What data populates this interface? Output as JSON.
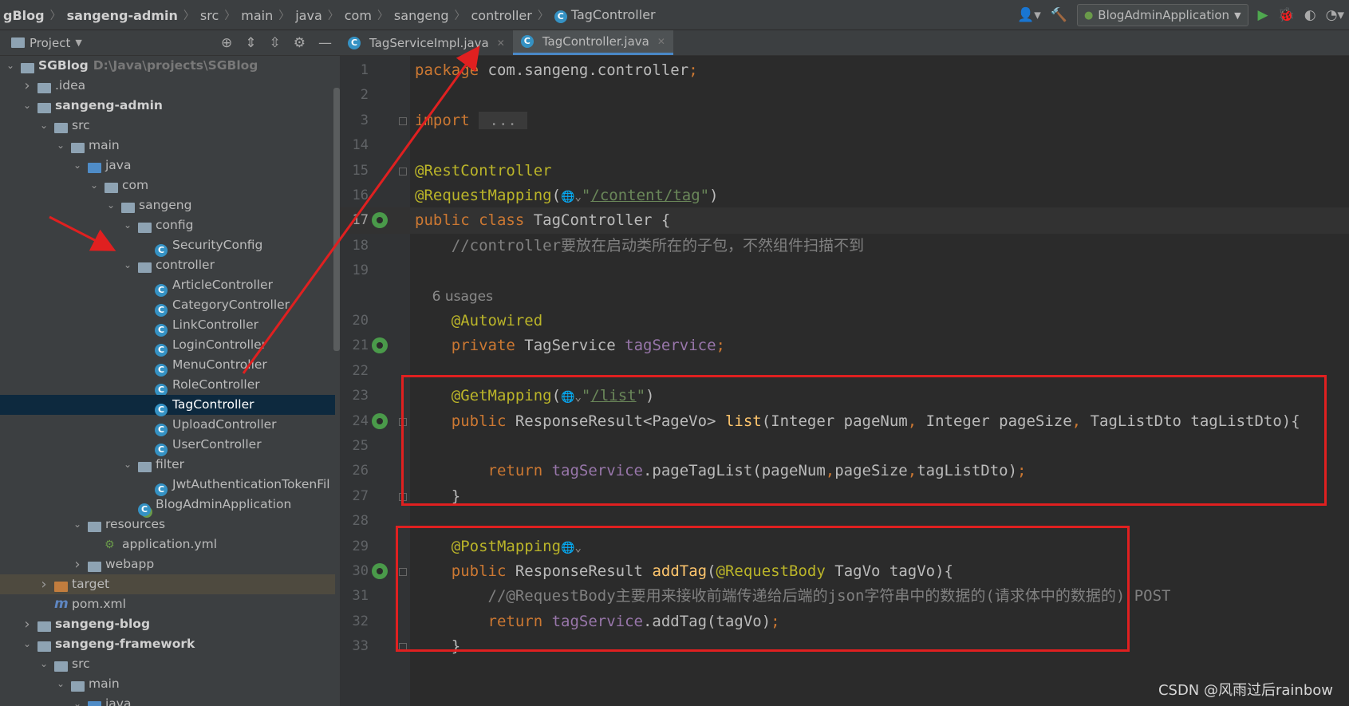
{
  "breadcrumb": [
    "gBlog",
    "sangeng-admin",
    "src",
    "main",
    "java",
    "com",
    "sangeng",
    "controller",
    "TagController"
  ],
  "run_config": "BlogAdminApplication",
  "project_panel": {
    "title": "Project",
    "tree": [
      {
        "label": "SGBlog",
        "path": "D:\\Java\\projects\\SGBlog",
        "bold": true,
        "depth": 0,
        "arrow": "open",
        "icon": "module"
      },
      {
        "label": ".idea",
        "depth": 1,
        "arrow": "closed",
        "icon": "folder"
      },
      {
        "label": "sangeng-admin",
        "depth": 1,
        "arrow": "open",
        "icon": "module",
        "bold": true
      },
      {
        "label": "src",
        "depth": 2,
        "arrow": "open",
        "icon": "folder"
      },
      {
        "label": "main",
        "depth": 3,
        "arrow": "open",
        "icon": "folder"
      },
      {
        "label": "java",
        "depth": 4,
        "arrow": "open",
        "icon": "folder-blue"
      },
      {
        "label": "com",
        "depth": 5,
        "arrow": "open",
        "icon": "folder"
      },
      {
        "label": "sangeng",
        "depth": 6,
        "arrow": "open",
        "icon": "folder"
      },
      {
        "label": "config",
        "depth": 7,
        "arrow": "open",
        "icon": "folder"
      },
      {
        "label": "SecurityConfig",
        "depth": 8,
        "arrow": "",
        "icon": "class"
      },
      {
        "label": "controller",
        "depth": 7,
        "arrow": "open",
        "icon": "folder"
      },
      {
        "label": "ArticleController",
        "depth": 8,
        "arrow": "",
        "icon": "class"
      },
      {
        "label": "CategoryController",
        "depth": 8,
        "arrow": "",
        "icon": "class"
      },
      {
        "label": "LinkController",
        "depth": 8,
        "arrow": "",
        "icon": "class"
      },
      {
        "label": "LoginController",
        "depth": 8,
        "arrow": "",
        "icon": "class"
      },
      {
        "label": "MenuController",
        "depth": 8,
        "arrow": "",
        "icon": "class"
      },
      {
        "label": "RoleController",
        "depth": 8,
        "arrow": "",
        "icon": "class"
      },
      {
        "label": "TagController",
        "depth": 8,
        "arrow": "",
        "icon": "class",
        "selected": true
      },
      {
        "label": "UploadController",
        "depth": 8,
        "arrow": "",
        "icon": "class"
      },
      {
        "label": "UserController",
        "depth": 8,
        "arrow": "",
        "icon": "class"
      },
      {
        "label": "filter",
        "depth": 7,
        "arrow": "open",
        "icon": "folder"
      },
      {
        "label": "JwtAuthenticationTokenFil",
        "depth": 8,
        "arrow": "",
        "icon": "class"
      },
      {
        "label": "BlogAdminApplication",
        "depth": 7,
        "arrow": "",
        "icon": "spring-class"
      },
      {
        "label": "resources",
        "depth": 4,
        "arrow": "open",
        "icon": "folder"
      },
      {
        "label": "application.yml",
        "depth": 5,
        "arrow": "",
        "icon": "spring-yml"
      },
      {
        "label": "webapp",
        "depth": 4,
        "arrow": "closed",
        "icon": "folder"
      },
      {
        "label": "target",
        "depth": 2,
        "arrow": "closed",
        "icon": "folder-orange",
        "target": true
      },
      {
        "label": "pom.xml",
        "depth": 2,
        "arrow": "",
        "icon": "maven"
      },
      {
        "label": "sangeng-blog",
        "depth": 1,
        "arrow": "closed",
        "icon": "module",
        "bold": true
      },
      {
        "label": "sangeng-framework",
        "depth": 1,
        "arrow": "open",
        "icon": "module",
        "bold": true
      },
      {
        "label": "src",
        "depth": 2,
        "arrow": "open",
        "icon": "folder"
      },
      {
        "label": "main",
        "depth": 3,
        "arrow": "open",
        "icon": "folder"
      },
      {
        "label": "java",
        "depth": 4,
        "arrow": "open",
        "icon": "folder-blue"
      }
    ]
  },
  "editor": {
    "tabs": [
      {
        "label": "TagServiceImpl.java",
        "active": false
      },
      {
        "label": "TagController.java",
        "active": true
      }
    ],
    "lines": [
      {
        "n": "1",
        "tokens": [
          [
            "kw",
            "package "
          ],
          [
            "",
            "com.sangeng.controller"
          ],
          [
            "kw",
            ";"
          ]
        ]
      },
      {
        "n": "2",
        "tokens": []
      },
      {
        "n": "3",
        "tokens": [
          [
            "kw",
            "import "
          ],
          [
            "fold",
            " ... "
          ]
        ],
        "gfold": true
      },
      {
        "n": "14",
        "tokens": []
      },
      {
        "n": "15",
        "tokens": [
          [
            "an",
            "@RestController"
          ]
        ],
        "gfold": true
      },
      {
        "n": "16",
        "tokens": [
          [
            "an",
            "@RequestMapping"
          ],
          [
            "",
            "("
          ],
          [
            "web",
            "🌐⌄"
          ],
          [
            "str",
            "\""
          ],
          [
            "lnk",
            "/content/tag"
          ],
          [
            "str",
            "\""
          ],
          [
            "",
            ")"
          ]
        ]
      },
      {
        "n": "17",
        "tokens": [
          [
            "kw",
            "public class "
          ],
          [
            "",
            "TagController "
          ],
          [
            "",
            "{"
          ]
        ],
        "current": true,
        "gicon": true
      },
      {
        "n": "18",
        "tokens": [
          [
            "cm",
            "    //controller要放在启动类所在的子包，不然组件扫描不到"
          ]
        ]
      },
      {
        "n": "19",
        "tokens": []
      },
      {
        "n": "",
        "tokens": [
          [
            "hint",
            "    6 usages"
          ]
        ]
      },
      {
        "n": "20",
        "tokens": [
          [
            "an",
            "    @Autowired"
          ]
        ]
      },
      {
        "n": "21",
        "tokens": [
          [
            "kw",
            "    private "
          ],
          [
            "",
            "TagService "
          ],
          [
            "fld",
            "tagService"
          ],
          [
            "kw",
            ";"
          ]
        ],
        "gicon": true
      },
      {
        "n": "22",
        "tokens": []
      },
      {
        "n": "23",
        "tokens": [
          [
            "an",
            "    @GetMapping"
          ],
          [
            "",
            "("
          ],
          [
            "web",
            "🌐⌄"
          ],
          [
            "str",
            "\""
          ],
          [
            "lnk",
            "/list"
          ],
          [
            "str",
            "\""
          ],
          [
            "",
            ")"
          ]
        ]
      },
      {
        "n": "24",
        "tokens": [
          [
            "kw",
            "    public "
          ],
          [
            "",
            "ResponseResult<PageVo> "
          ],
          [
            "fn",
            "list"
          ],
          [
            "",
            "(Integer pageNum"
          ],
          [
            "kw",
            ", "
          ],
          [
            "",
            "Integer pageSize"
          ],
          [
            "kw",
            ", "
          ],
          [
            "",
            "TagListDto tagListDto){"
          ]
        ],
        "gicon": true,
        "gfold": true
      },
      {
        "n": "25",
        "tokens": []
      },
      {
        "n": "26",
        "tokens": [
          [
            "kw",
            "        return "
          ],
          [
            "fld",
            "tagService"
          ],
          [
            "",
            ".pageTagList(pageNum"
          ],
          [
            "kw",
            ","
          ],
          [
            "",
            "pageSize"
          ],
          [
            "kw",
            ","
          ],
          [
            "",
            "tagListDto)"
          ],
          [
            "kw",
            ";"
          ]
        ]
      },
      {
        "n": "27",
        "tokens": [
          [
            "",
            "    }"
          ]
        ],
        "gfold": true
      },
      {
        "n": "28",
        "tokens": []
      },
      {
        "n": "29",
        "tokens": [
          [
            "an",
            "    @PostMapping"
          ],
          [
            "web",
            "🌐⌄"
          ]
        ]
      },
      {
        "n": "30",
        "tokens": [
          [
            "kw",
            "    public "
          ],
          [
            "",
            "ResponseResult "
          ],
          [
            "fn",
            "addTag"
          ],
          [
            "",
            "("
          ],
          [
            "an",
            "@RequestBody "
          ],
          [
            "",
            "TagVo tagVo){"
          ]
        ],
        "gicon": true,
        "gfold": true
      },
      {
        "n": "31",
        "tokens": [
          [
            "cm",
            "        //@RequestBody主要用来接收前端传递给后端的json字符串中的数据的(请求体中的数据的) POST"
          ]
        ]
      },
      {
        "n": "32",
        "tokens": [
          [
            "kw",
            "        return "
          ],
          [
            "fld",
            "tagService"
          ],
          [
            "",
            ".addTag(tagVo)"
          ],
          [
            "kw",
            ";"
          ]
        ]
      },
      {
        "n": "33",
        "tokens": [
          [
            "",
            "    }"
          ]
        ],
        "gfold": true
      }
    ]
  },
  "watermark": "CSDN @风雨过后rainbow"
}
